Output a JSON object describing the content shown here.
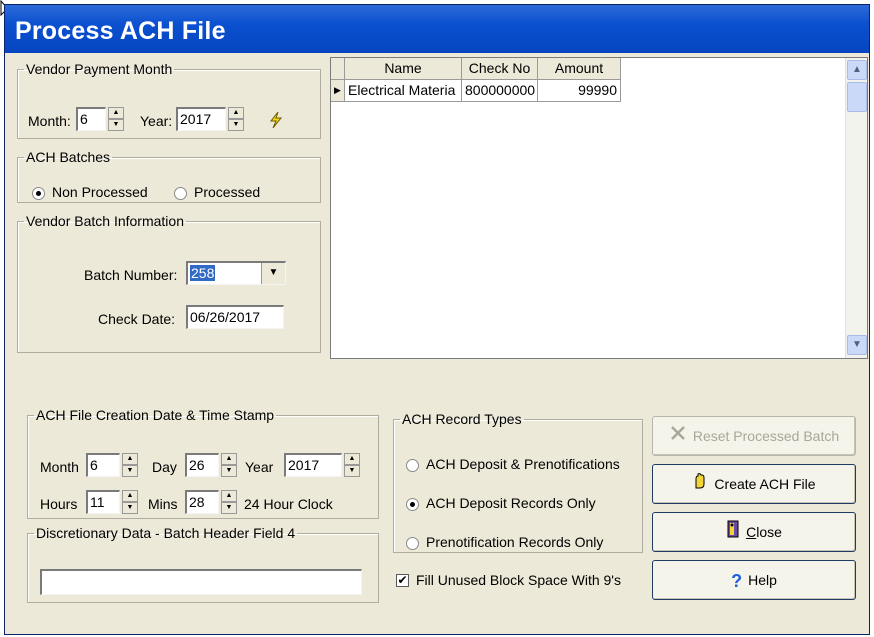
{
  "window": {
    "title": "Process ACH File"
  },
  "vendor_payment_month": {
    "legend": "Vendor Payment Month",
    "month_label": "Month:",
    "month_value": "6",
    "year_label": "Year:",
    "year_value": "2017"
  },
  "ach_batches": {
    "legend": "ACH Batches",
    "options": [
      {
        "label": "Non Processed",
        "selected": true
      },
      {
        "label": "Processed",
        "selected": false
      }
    ]
  },
  "vendor_batch_info": {
    "legend": "Vendor Batch Information",
    "batch_number_label": "Batch Number:",
    "batch_number_value": "258",
    "check_date_label": "Check Date:",
    "check_date_value": "06/26/2017"
  },
  "payments_grid": {
    "columns": [
      "Name",
      "Check No",
      "Amount"
    ],
    "rows": [
      {
        "name": "Electrical Materia",
        "check_no": "800000000",
        "amount": "99990"
      }
    ]
  },
  "ach_file_creation": {
    "legend": "ACH File Creation Date & Time Stamp",
    "month_label": "Month",
    "month_value": "6",
    "day_label": "Day",
    "day_value": "26",
    "year_label": "Year",
    "year_value": "2017",
    "hours_label": "Hours",
    "hours_value": "11",
    "mins_label": "Mins",
    "mins_value": "28",
    "clock_note": "24 Hour Clock"
  },
  "discretionary": {
    "legend": "Discretionary Data - Batch Header Field 4",
    "value": ""
  },
  "ach_record_types": {
    "legend": "ACH Record Types",
    "options": [
      {
        "label": "ACH Deposit & Prenotifications",
        "selected": false
      },
      {
        "label": "ACH Deposit Records Only",
        "selected": true
      },
      {
        "label": "Prenotification Records Only",
        "selected": false
      }
    ]
  },
  "fill_unused": {
    "label": "Fill Unused Block Space With 9's",
    "checked": true
  },
  "buttons": {
    "reset": "Reset Processed Batch",
    "create": "Create ACH File",
    "close_prefix": "",
    "close_hotkey": "C",
    "close_rest": "lose",
    "help": "Help"
  },
  "icons": {
    "lightning": "lightning-icon",
    "reset": "x-icon",
    "create": "hand-icon",
    "close": "door-exit-icon",
    "help": "question-icon"
  },
  "colors": {
    "title_bar": "#0a50d0",
    "window_bg": "#ece9d8",
    "selection": "#316ac5"
  }
}
